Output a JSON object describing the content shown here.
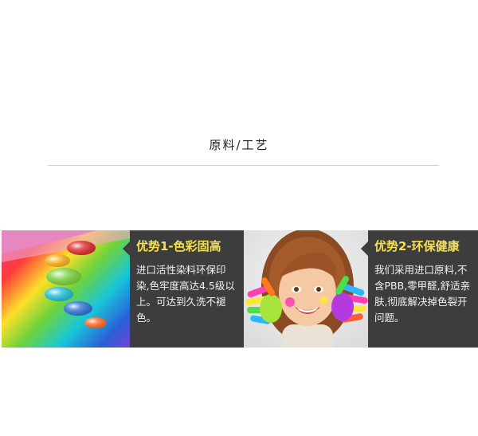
{
  "section": {
    "title": "原料/工艺"
  },
  "features": [
    {
      "title": "优势1-色彩固高",
      "body": "进口活性染料环保印染,色牢度高达4.5级以上。可达到久洗不褪色。"
    },
    {
      "title": "优势2-环保健康",
      "body": "我们采用进口原料,不含PBB,零甲醛,舒适亲肤,彻底解决掉色裂开问题。"
    }
  ],
  "colors": {
    "accent_title": "#f6e14b",
    "panel_bg": "#3d3d3d",
    "divider": "#cfcfcf"
  },
  "images": [
    "rainbow-drops-image",
    "child-painted-hands-image"
  ]
}
